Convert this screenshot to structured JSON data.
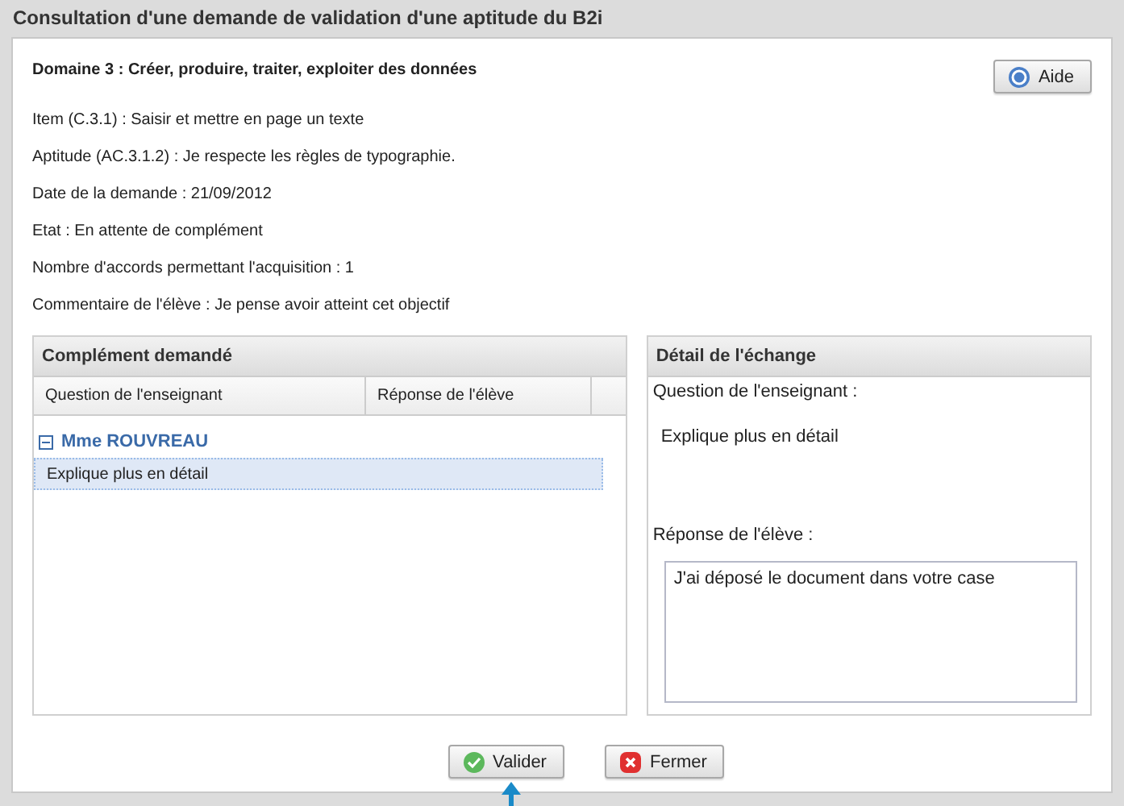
{
  "window": {
    "title": "Consultation d'une demande de validation d'une aptitude du B2i"
  },
  "domain": "Domaine 3 : Créer, produire, traiter, exploiter des données",
  "help_button": "Aide",
  "details": [
    "Item (C.3.1) : Saisir et mettre en page un texte",
    "Aptitude (AC.3.1.2) : Je respecte les règles de typographie.",
    "Date de la demande : 21/09/2012",
    "Etat : En attente de complément",
    "Nombre d'accords permettant l'acquisition : 1",
    "Commentaire de l'élève :  Je pense avoir atteint cet objectif"
  ],
  "complement": {
    "title": "Complément demandé",
    "columns": [
      "Question de l'enseignant",
      "Réponse de l'élève"
    ],
    "groups": [
      {
        "label": "Mme ROUVREAU",
        "expanded": true,
        "rows": [
          {
            "cells": [
              "Explique plus en détail",
              ""
            ],
            "selected": true
          }
        ]
      }
    ]
  },
  "exchange": {
    "title": "Détail de l'échange",
    "question_label": "Question de l'enseignant :",
    "question": "Explique plus en détail",
    "answer_label": "Réponse de l'élève :",
    "answer": "J'ai déposé le document dans votre case"
  },
  "buttons": [
    {
      "label": "Valider",
      "kind": "ok"
    },
    {
      "label": "Fermer",
      "kind": "cancel"
    }
  ]
}
